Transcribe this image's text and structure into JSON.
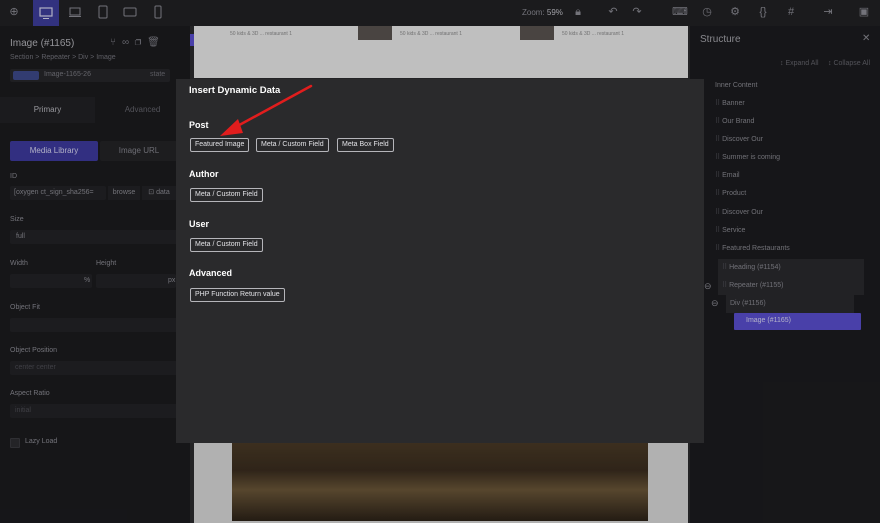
{
  "toolbar": {
    "zoom_label": "Zoom:",
    "zoom_value": "59%"
  },
  "left_panel": {
    "element_title": "Image (#1165)",
    "breadcrumb": "Section > Repeater > Div > Image",
    "class_chip": "Image-1165-26",
    "state_label": "state",
    "tab_primary": "Primary",
    "tab_advanced": "Advanced",
    "btn_media_library": "Media Library",
    "btn_image_url": "Image URL",
    "id_label": "ID",
    "id_value": "[oxygen ct_sign_sha256=",
    "browse": "browse",
    "data": "data",
    "size_label": "Size",
    "size_value": "full",
    "width_label": "Width",
    "height_label": "Height",
    "unit_pct": "%",
    "unit_px": "px",
    "object_fit_label": "Object Fit",
    "object_position_label": "Object Position",
    "object_position_placeholder": "center center",
    "aspect_ratio_label": "Aspect Ratio",
    "aspect_ratio_placeholder": "initial",
    "lazy_load_label": "Lazy Load"
  },
  "canvas": {
    "thumb_captions": [
      "50 kids & 3D ... restaurant 1",
      "50 kids & 3D ... restaurant 1",
      "50 kids & 3D ... restaurant 1"
    ]
  },
  "structure": {
    "title": "Structure",
    "expand_all": "Expand All",
    "collapse_all": "Collapse All",
    "items": [
      {
        "label": "Inner Content"
      },
      {
        "label": "Banner"
      },
      {
        "label": "Our Brand"
      },
      {
        "label": "Discover Our"
      },
      {
        "label": "Summer is coming"
      },
      {
        "label": "Email"
      },
      {
        "label": "Product"
      },
      {
        "label": "Discover Our"
      },
      {
        "label": "Service"
      },
      {
        "label": "Featured Restaurants"
      },
      {
        "label": "Heading (#1154)"
      },
      {
        "label": "Repeater (#1155)"
      },
      {
        "label": "Div (#1156)"
      },
      {
        "label": "Image (#1165)"
      }
    ]
  },
  "modal": {
    "title": "Insert Dynamic Data",
    "sections": [
      {
        "heading": "Post",
        "options": [
          "Featured Image",
          "Meta / Custom Field",
          "Meta Box Field"
        ]
      },
      {
        "heading": "Author",
        "options": [
          "Meta / Custom Field"
        ]
      },
      {
        "heading": "User",
        "options": [
          "Meta / Custom Field"
        ]
      },
      {
        "heading": "Advanced",
        "options": [
          "PHP Function Return value"
        ]
      }
    ]
  },
  "colors": {
    "accent": "#5a4fcf",
    "arrow": "#e11d1d",
    "modal_bg": "#2a2a2c"
  }
}
